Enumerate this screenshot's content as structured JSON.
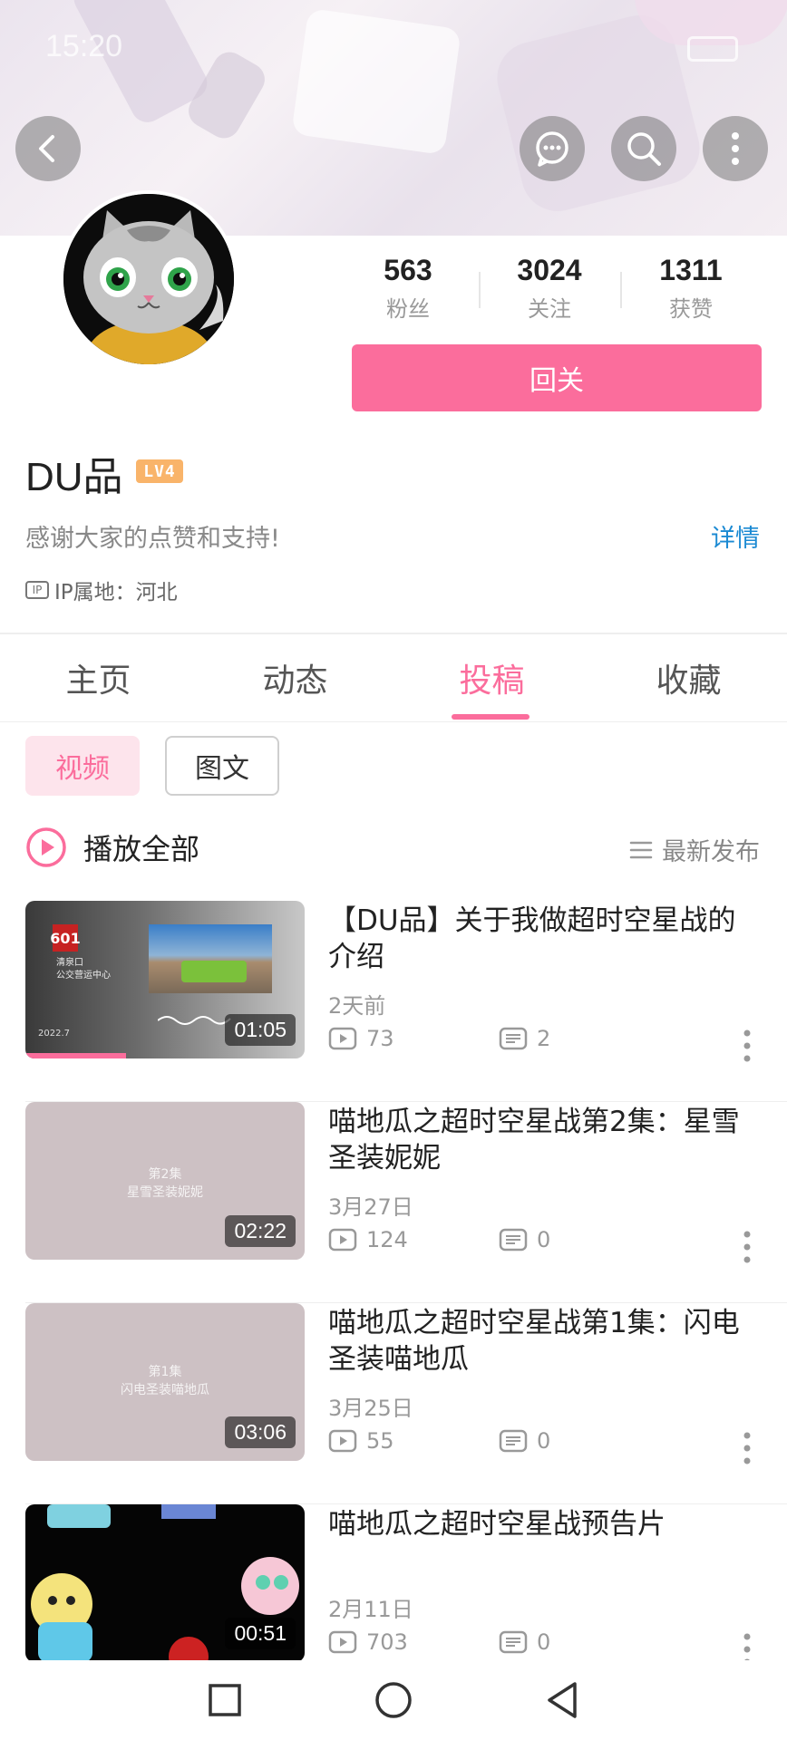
{
  "status": {
    "time": "15:20"
  },
  "profile": {
    "name": "DU品",
    "level": "LV4",
    "bio": "感谢大家的点赞和支持!",
    "detail_label": "详情",
    "ip_label": "IP属地：河北",
    "ip_icon_text": "IP",
    "stats": [
      {
        "value": "563",
        "label": "粉丝"
      },
      {
        "value": "3024",
        "label": "关注"
      },
      {
        "value": "1311",
        "label": "获赞"
      }
    ],
    "follow_label": "回关"
  },
  "tabs": [
    {
      "label": "主页",
      "active": false
    },
    {
      "label": "动态",
      "active": false
    },
    {
      "label": "投稿",
      "active": true
    },
    {
      "label": "收藏",
      "active": false
    }
  ],
  "chips": {
    "video": "视频",
    "graphic": "图文"
  },
  "list_header": {
    "play_all": "播放全部",
    "sort": "最新发布"
  },
  "videos": [
    {
      "title": "【DU品】关于我做超时空星战的介绍",
      "date": "2天前",
      "plays": "73",
      "comments": "2",
      "duration": "01:05",
      "progress": 0.36
    },
    {
      "title": "喵地瓜之超时空星战第2集：星雪圣装妮妮",
      "date": "3月27日",
      "plays": "124",
      "comments": "0",
      "duration": "02:22",
      "thumb_line1": "第2集",
      "thumb_line2": "星雪圣装妮妮"
    },
    {
      "title": "喵地瓜之超时空星战第1集：闪电圣装喵地瓜",
      "date": "3月25日",
      "plays": "55",
      "comments": "0",
      "duration": "03:06",
      "thumb_line1": "第1集",
      "thumb_line2": "闪电圣装喵地瓜"
    },
    {
      "title": "喵地瓜之超时空星战预告片",
      "date": "2月11日",
      "plays": "703",
      "comments": "0",
      "duration": "00:51"
    }
  ],
  "thumb1_text": {
    "badge": "601",
    "line1": "清泉口",
    "line2": "公交营运中心",
    "watermark": "2022.7"
  },
  "colors": {
    "accent": "#fb6d9c",
    "link": "#1b8ad3",
    "muted": "#999999"
  }
}
